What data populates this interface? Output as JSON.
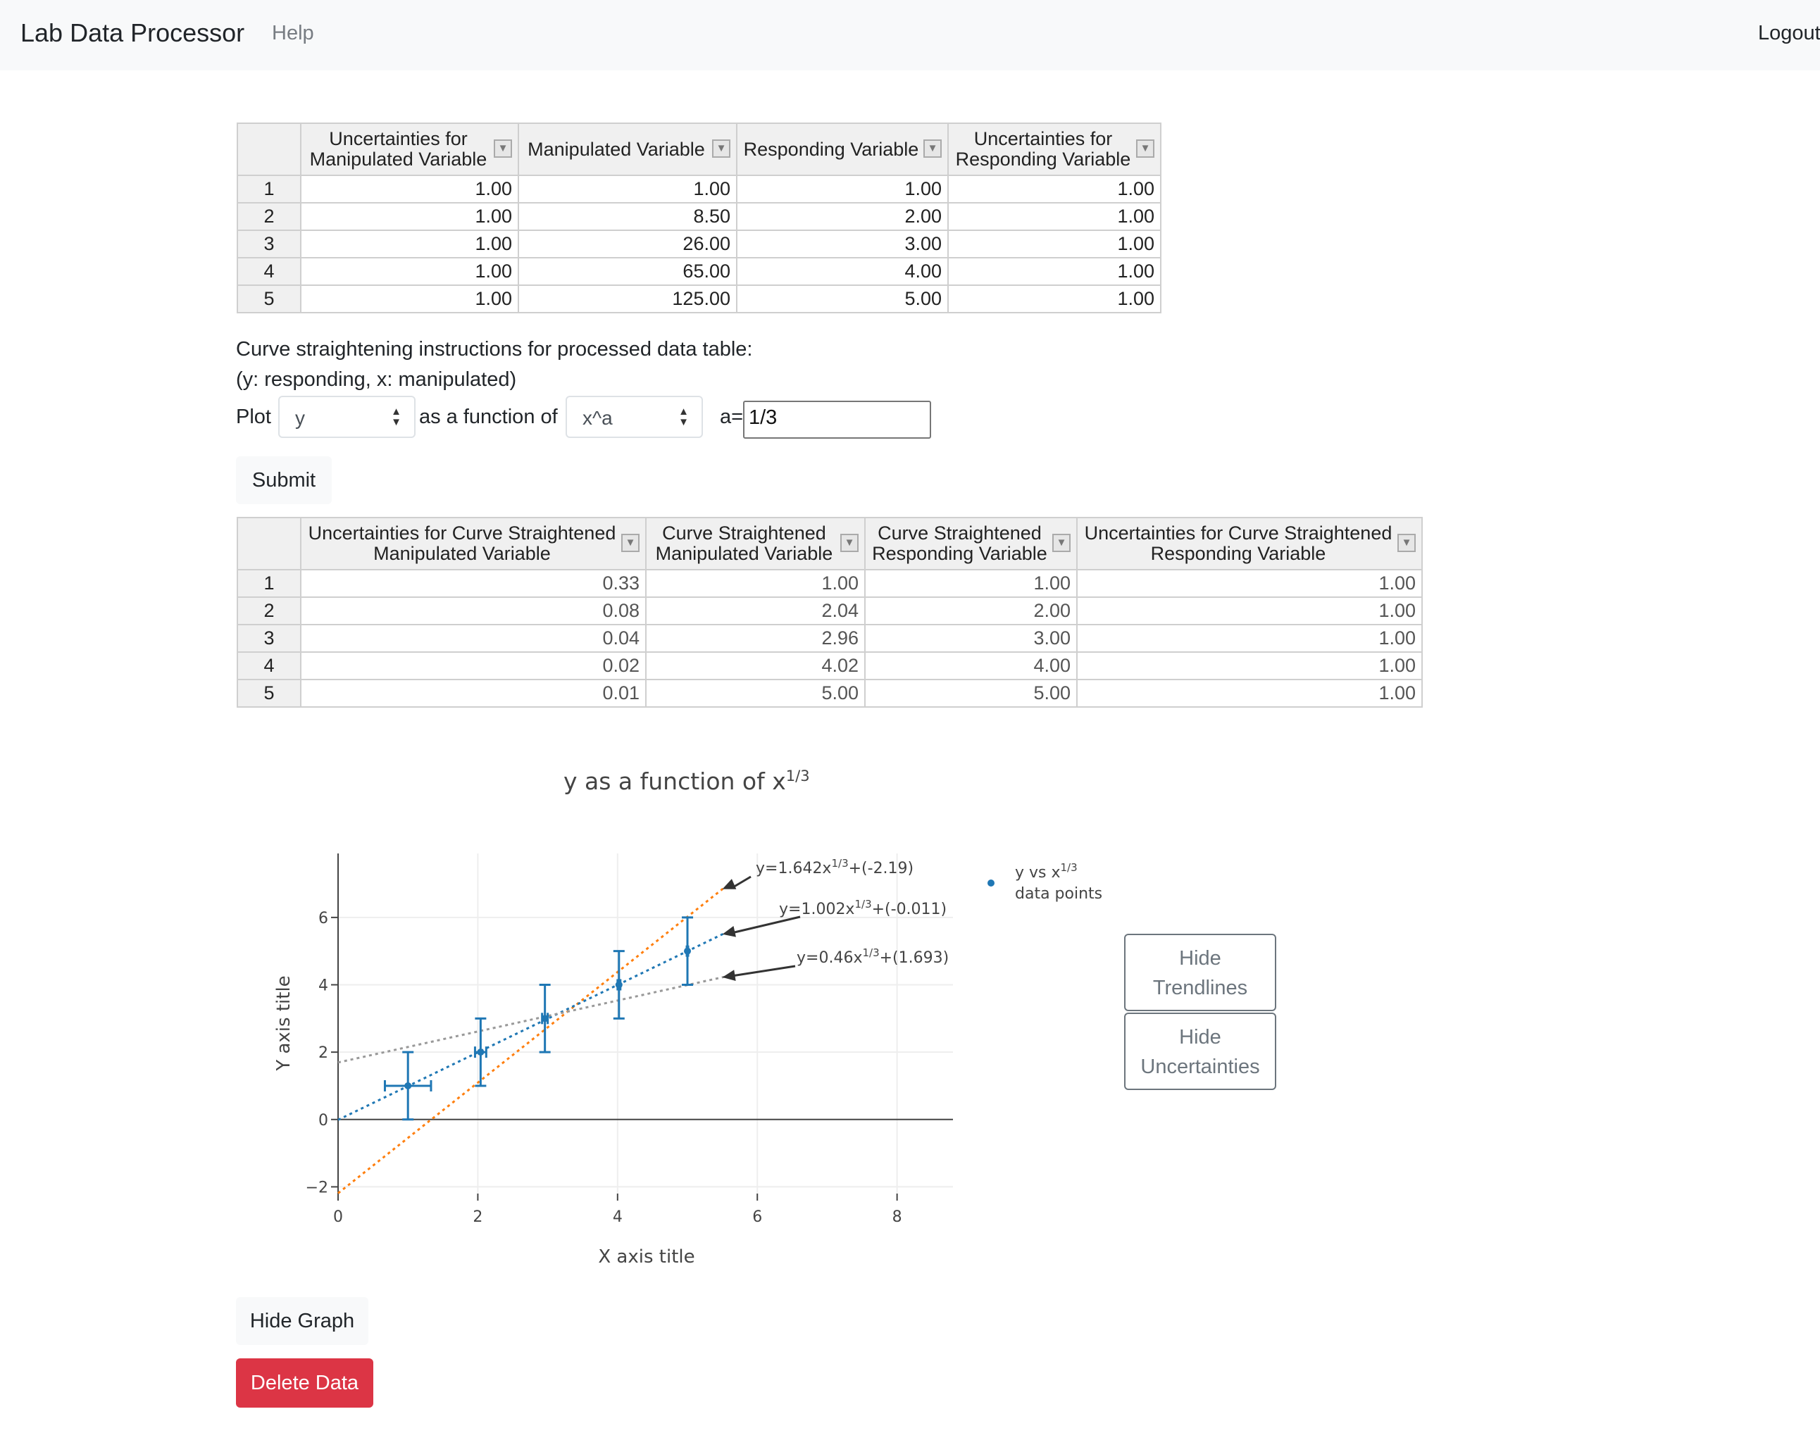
{
  "nav": {
    "brand": "Lab Data Processor",
    "help": "Help",
    "logout": "Logout"
  },
  "raw_table": {
    "headers": [
      "Uncertainties for Manipulated Variable",
      "Manipulated Variable",
      "Responding Variable",
      "Uncertainties for Responding Variable"
    ],
    "rows": [
      [
        "1",
        "1.00",
        "1.00",
        "1.00",
        "1.00"
      ],
      [
        "2",
        "1.00",
        "8.50",
        "2.00",
        "1.00"
      ],
      [
        "3",
        "1.00",
        "26.00",
        "3.00",
        "1.00"
      ],
      [
        "4",
        "1.00",
        "65.00",
        "4.00",
        "1.00"
      ],
      [
        "5",
        "1.00",
        "125.00",
        "5.00",
        "1.00"
      ]
    ]
  },
  "instructions": {
    "line1": "Curve straightening instructions for processed data table:",
    "line2": "(y: responding, x: manipulated)",
    "plot_label": "Plot",
    "y_select": "y",
    "func_label": "as a function of",
    "x_select": "x^a",
    "a_label": "a=",
    "a_value": "1/3",
    "submit": "Submit"
  },
  "processed_table": {
    "headers": [
      "Uncertainties for Curve Straightened Manipulated Variable",
      "Curve Straightened Manipulated Variable",
      "Curve Straightened Responding Variable",
      "Uncertainties for Curve Straightened Responding Variable"
    ],
    "rows": [
      [
        "1",
        "0.33",
        "1.00",
        "1.00",
        "1.00"
      ],
      [
        "2",
        "0.08",
        "2.04",
        "2.00",
        "1.00"
      ],
      [
        "3",
        "0.04",
        "2.96",
        "3.00",
        "1.00"
      ],
      [
        "4",
        "0.02",
        "4.02",
        "4.00",
        "1.00"
      ],
      [
        "5",
        "0.01",
        "5.00",
        "5.00",
        "1.00"
      ]
    ]
  },
  "chart_data": {
    "type": "scatter",
    "title": "y as a function of x^(1/3)",
    "xlabel": "X axis title",
    "ylabel": "Y axis title",
    "xlim": [
      0,
      8.8
    ],
    "ylim": [
      -2.2,
      7.9
    ],
    "xticks": [
      0,
      2,
      4,
      6,
      8
    ],
    "yticks": [
      -2,
      0,
      2,
      4,
      6
    ],
    "grid": true,
    "legend_position": "right",
    "series": [
      {
        "name": "y vs x^(1/3) data points",
        "color": "#1f77b4",
        "x": [
          1.0,
          2.04,
          2.96,
          4.02,
          5.0
        ],
        "y": [
          1.0,
          2.0,
          3.0,
          4.0,
          5.0
        ],
        "x_err": [
          0.33,
          0.08,
          0.04,
          0.02,
          0.01
        ],
        "y_err": [
          1.0,
          1.0,
          1.0,
          1.0,
          1.0
        ]
      }
    ],
    "trendlines": [
      {
        "label": "y=1.642x^(1/3)+(-2.19)",
        "slope": 1.642,
        "intercept": -2.19,
        "color": "#ff7f0e"
      },
      {
        "label": "y=1.002x^(1/3)+(-0.011)",
        "slope": 1.002,
        "intercept": -0.011,
        "color": "#1f77b4"
      },
      {
        "label": "y=0.46x^(1/3)+(1.693)",
        "slope": 0.46,
        "intercept": 1.693,
        "color": "#999999"
      }
    ]
  },
  "side_buttons": {
    "trendlines": [
      "Hide",
      "Trendlines"
    ],
    "uncertainties": [
      "Hide",
      "Uncertainties"
    ]
  },
  "graph_buttons": {
    "hide_graph": "Hide Graph",
    "delete_data": "Delete Data"
  }
}
